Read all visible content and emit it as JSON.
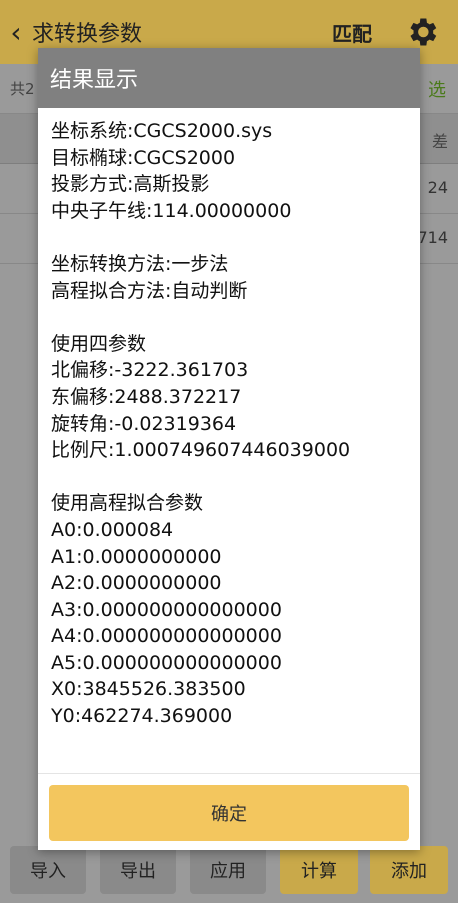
{
  "header": {
    "back_glyph": "‹",
    "title": "求转换参数",
    "match_label": "匹配",
    "gear_icon": "gear-icon"
  },
  "subbar": {
    "count_partial": "共2",
    "select_partial": "选"
  },
  "table": {
    "header_partial": "差",
    "rows": [
      {
        "value_partial": "24"
      },
      {
        "value_partial": "714"
      }
    ]
  },
  "toolbar": {
    "buttons": [
      {
        "label": "导入"
      },
      {
        "label": "导出"
      },
      {
        "label": "应用"
      },
      {
        "label": "计算"
      },
      {
        "label": "添加"
      }
    ]
  },
  "dialog": {
    "title": "结果显示",
    "lines": [
      "坐标系统:CGCS2000.sys",
      "目标椭球:CGCS2000",
      "投影方式:高斯投影",
      "中央子午线:114.00000000",
      "",
      "坐标转换方法:一步法",
      "高程拟合方法:自动判断",
      "",
      "使用四参数",
      "北偏移:-3222.361703",
      "东偏移:2488.372217",
      "旋转角:-0.02319364",
      "比例尺:1.000749607446039000",
      "",
      "使用高程拟合参数",
      "A0:0.000084",
      "A1:0.0000000000",
      "A2:0.0000000000",
      "A3:0.000000000000000",
      "A4:0.000000000000000",
      "A5:0.000000000000000",
      "X0:3845526.383500",
      "Y0:462274.369000"
    ],
    "confirm_label": "确定"
  },
  "colors": {
    "accent": "#c9a94a",
    "confirm": "#f3c65e",
    "dialog_header": "#808080",
    "overlay": "#9a9a9a"
  }
}
